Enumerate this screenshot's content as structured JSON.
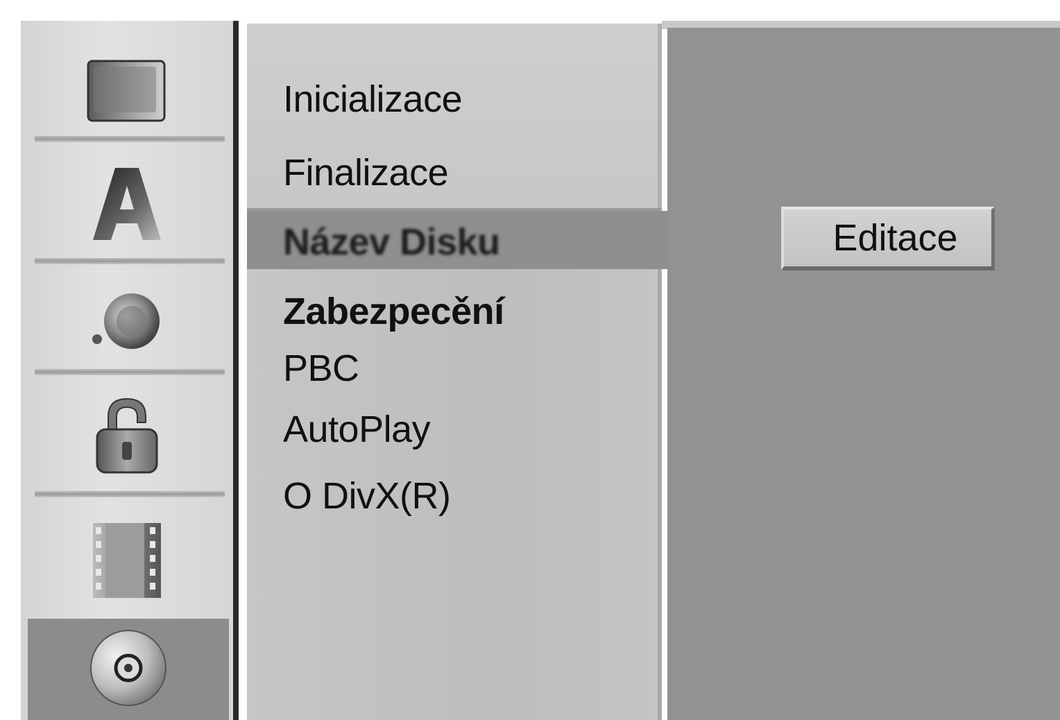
{
  "sidebar": {
    "icons": [
      {
        "name": "tv-screen-icon"
      },
      {
        "name": "language-a-icon"
      },
      {
        "name": "audio-speaker-icon"
      },
      {
        "name": "lock-icon"
      },
      {
        "name": "film-strip-icon"
      },
      {
        "name": "disc-icon",
        "active": true
      }
    ]
  },
  "menu": {
    "items": [
      {
        "label": "Inicializace"
      },
      {
        "label": "Finalizace"
      },
      {
        "label": "Název Disku",
        "selected": true
      },
      {
        "label": "Zabezpecění"
      },
      {
        "label": "PBC"
      },
      {
        "label": "AutoPlay"
      },
      {
        "label": "O DivX(R)"
      }
    ]
  },
  "content": {
    "edit_button_label": "Editace"
  },
  "colors": {
    "sidebar_bg": "#dcdcdc",
    "menu_bg": "#c2c2c2",
    "selected_bar": "#8f8f8f",
    "content_bg": "#929292",
    "text": "#111111"
  }
}
